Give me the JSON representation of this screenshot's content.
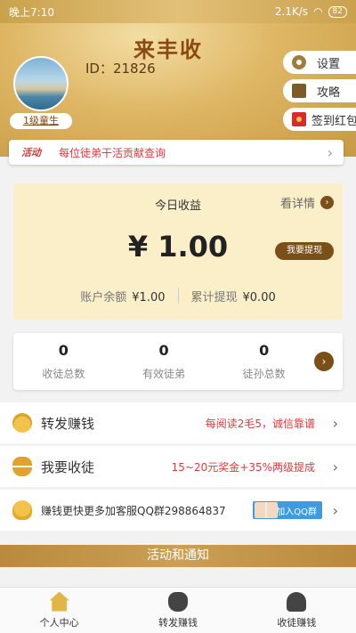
{
  "status_bar": {
    "time": "晚上7:10",
    "speed": "2.1K/s",
    "battery": "82"
  },
  "header": {
    "app_title": "来丰收",
    "user_id": "ID：21826",
    "level": "1级童生",
    "side_buttons": [
      {
        "label": "设置",
        "icon": "gear-icon"
      },
      {
        "label": "攻略",
        "icon": "book-icon"
      },
      {
        "label": "签到红包",
        "icon": "red-packet-icon"
      }
    ]
  },
  "activity": {
    "tag": "活动",
    "text": "每位徒弟干活贡献查询"
  },
  "earnings": {
    "title": "今日收益",
    "detail_link": "看详情",
    "amount": "¥ 1.00",
    "withdraw_label": "我要提现",
    "balance_label": "账户余额",
    "balance_value": "¥1.00",
    "total_withdraw_label": "累计提现",
    "total_withdraw_value": "¥0.00"
  },
  "stats": [
    {
      "value": "0",
      "label": "收徒总数"
    },
    {
      "value": "0",
      "label": "有效徒弟"
    },
    {
      "value": "0",
      "label": "徒孙总数"
    }
  ],
  "menu": {
    "share": {
      "label": "转发赚钱",
      "sub": "每阅读2毛5，诚信靠谱"
    },
    "recruit": {
      "label": "我要收徒",
      "sub": "15~20元奖金+35%两级提成"
    },
    "qq": {
      "label": "赚钱更快更多加客服QQ群298864837",
      "button": "加入QQ群"
    }
  },
  "section_title": "活动和通知",
  "tabs": [
    {
      "label": "个人中心",
      "icon": "home-icon"
    },
    {
      "label": "转发赚钱",
      "icon": "money-bag-icon"
    },
    {
      "label": "收徒赚钱",
      "icon": "add-user-icon"
    }
  ],
  "colors": {
    "gold": "#c79a43",
    "brown": "#7a4f18",
    "accent_red": "#e23a3a",
    "card_bg": "#faefc8"
  }
}
